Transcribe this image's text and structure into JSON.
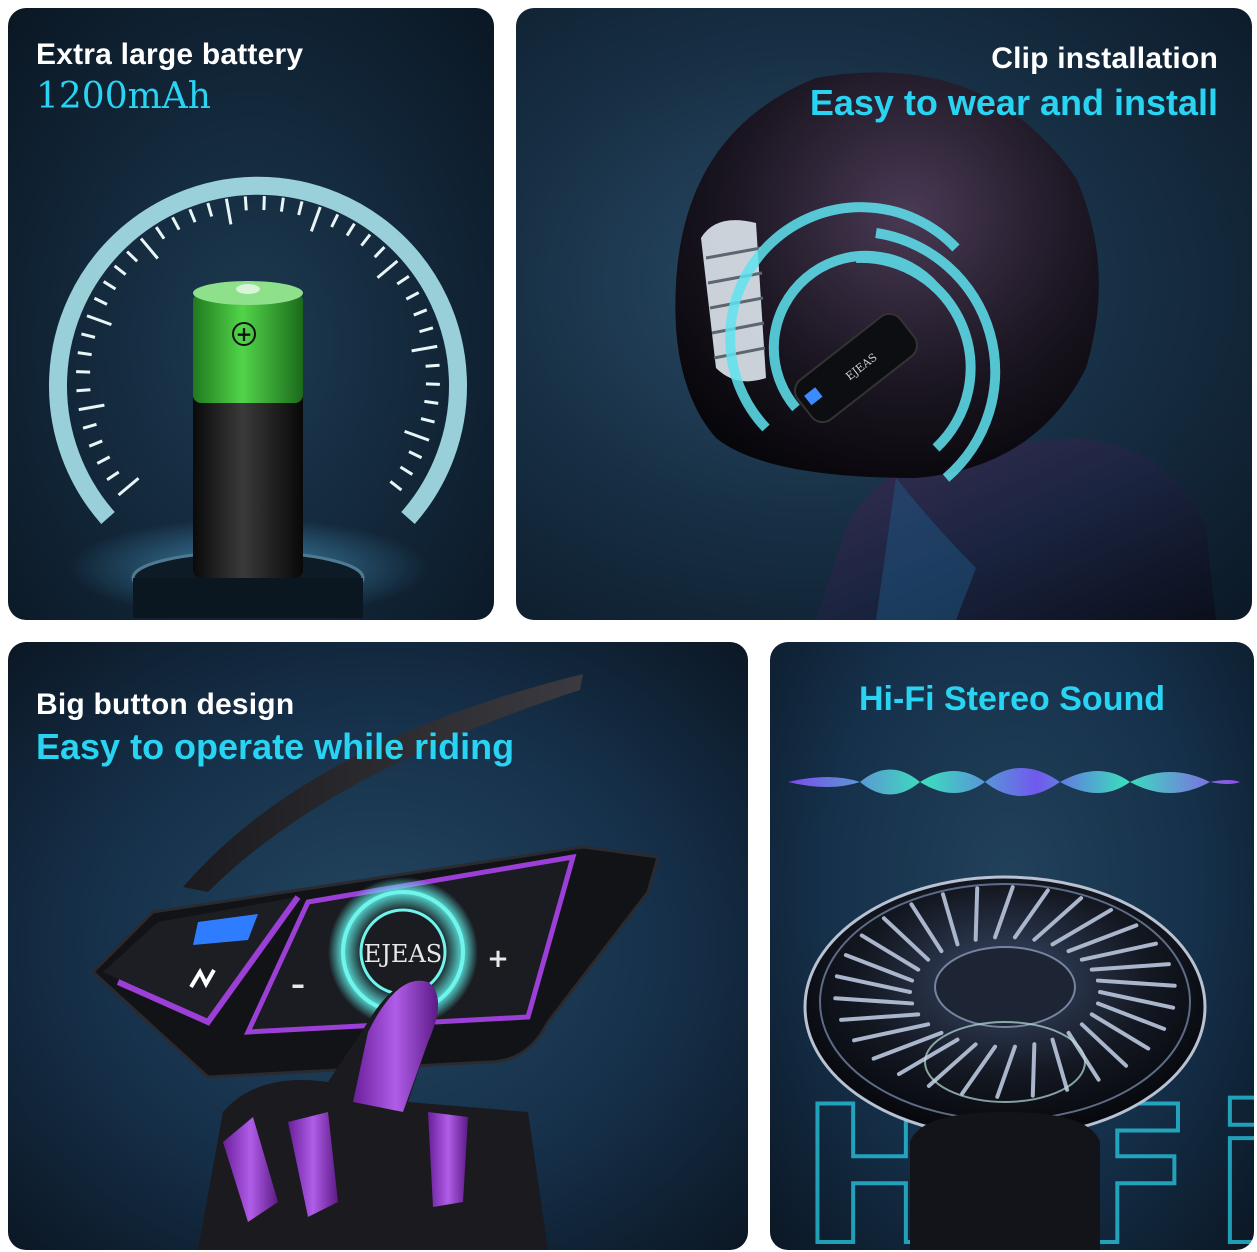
{
  "panels": {
    "battery": {
      "title": "Extra large battery",
      "subtitle": "1200mAh",
      "battery_symbol": "+"
    },
    "clip": {
      "title": "Clip installation",
      "subtitle": "Easy to wear and install",
      "device_brand": "EJEAS"
    },
    "button": {
      "title": "Big button design",
      "subtitle": "Easy to operate while riding",
      "device_brand": "EJEAS",
      "minus_label": "–",
      "plus_label": "+"
    },
    "sound": {
      "title": "Hi-Fi Stereo Sound",
      "background_letters": "HiFi"
    }
  },
  "colors": {
    "accent_cyan": "#29d3f2",
    "accent_purple": "#9b3fd6",
    "battery_green": "#3fbf3a",
    "panel_dark": "#0f2233"
  }
}
